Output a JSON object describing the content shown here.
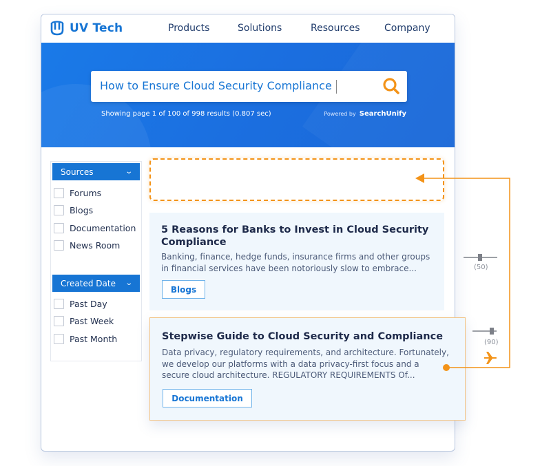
{
  "brand": {
    "name": "UV Tech",
    "logo_icon": "uv-logo-icon"
  },
  "nav": {
    "items": [
      {
        "label": "Products"
      },
      {
        "label": "Solutions"
      },
      {
        "label": "Resources"
      },
      {
        "label": "Company"
      }
    ]
  },
  "search": {
    "query": "How to Ensure Cloud Security Compliance",
    "icon": "search-icon",
    "stats": "Showing page 1 of 100 of 998 results (0.807 sec)",
    "powered_by_label": "Powered by",
    "powered_by_brand": "SearchUnify"
  },
  "facets": [
    {
      "title": "Sources",
      "options": [
        "Forums",
        "Blogs",
        "Documentation",
        "News Room"
      ]
    },
    {
      "title": "Created Date",
      "options": [
        "Past Day",
        "Past Week",
        "Past Month"
      ]
    }
  ],
  "results": [
    {
      "title": "5 Reasons for Banks to Invest in Cloud Security Compliance",
      "title_line1": "5 Reasons for Banks to Invest in Cloud Security",
      "title_line2": "Compliance",
      "desc_line1": "Banking, finance, hedge funds, insurance firms and other groups",
      "desc_line2": "in financial services have been notoriously slow to embrace...",
      "tag": "Blogs",
      "score": 50,
      "score_label": "(50)"
    },
    {
      "title": "Stepwise Guide to Cloud Security and Compliance",
      "desc_line1": "Data privacy, regulatory requirements, and architecture. Fortunately,",
      "desc_line2": "we develop our platforms with a data privacy-first focus and a",
      "desc_line3": "secure cloud architecture. REGULATORY REQUIREMENTS Of...",
      "tag": "Documentation",
      "score": 90,
      "score_label": "(90)"
    }
  ],
  "colors": {
    "brand_blue": "#1775d4",
    "accent_orange": "#f39318",
    "hero_blue": "#1a6fe0",
    "card_bg": "#f0f7fd"
  },
  "annotation": {
    "boost_icon": "airplane-icon",
    "target": "empty-result-slot"
  }
}
